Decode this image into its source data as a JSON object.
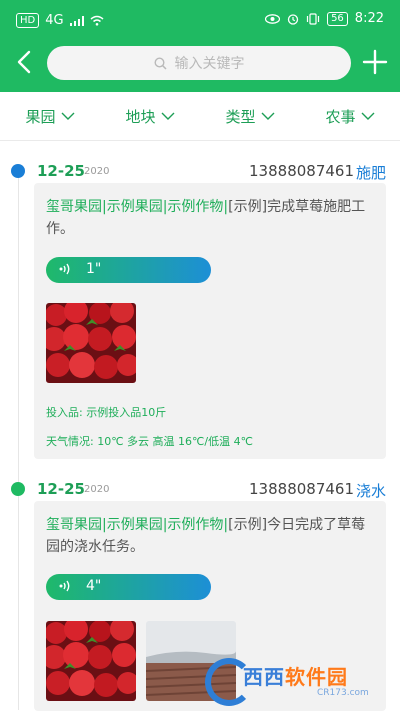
{
  "status_bar": {
    "network": "HD",
    "signal": "4G",
    "battery": "56",
    "time": "8:22"
  },
  "search": {
    "placeholder": "输入关键字"
  },
  "filters": [
    "果园",
    "地块",
    "类型",
    "农事"
  ],
  "entries": [
    {
      "date": "12-25",
      "year": "2020",
      "phone": "13888087461",
      "task": "施肥",
      "dot_color": "#1a7ed6",
      "desc_highlight": "玺哥果园|示例果园|示例作物|",
      "desc_rest": "[示例]完成草莓施肥工作。",
      "voice_length": "1\"",
      "input_label": "投入品: 示例投入品10斤",
      "weather_label": "天气情况: 10℃ 多云 高温 16℃/低温 4℃"
    },
    {
      "date": "12-25",
      "year": "2020",
      "phone": "13888087461",
      "task": "浇水",
      "dot_color": "#1fba62",
      "desc_highlight": "玺哥果园|示例果园|示例作物|",
      "desc_rest": "[示例]今日完成了草莓园的浇水任务。",
      "voice_length": "4\""
    }
  ],
  "watermark": {
    "text_a": "西西",
    "text_b": "软件园",
    "url": "CR173.com"
  }
}
